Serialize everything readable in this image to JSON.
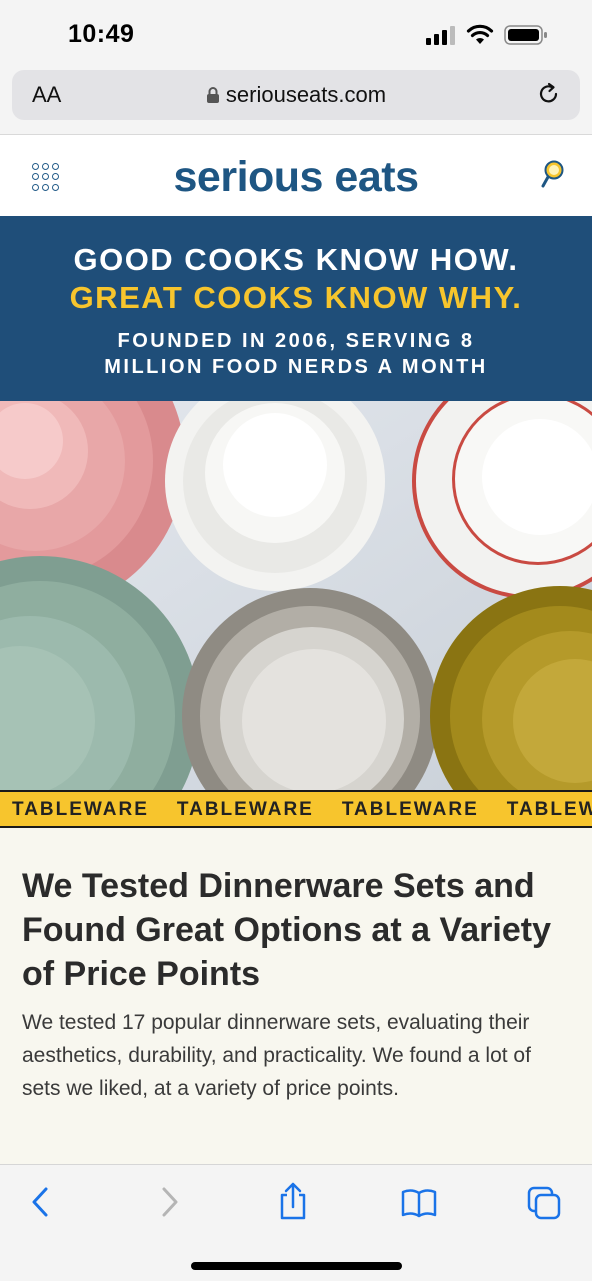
{
  "status_bar": {
    "time": "10:49"
  },
  "browser": {
    "text_size_label": "AA",
    "url": "seriouseats.com"
  },
  "site": {
    "logo": "serious eats"
  },
  "banner": {
    "line1": "GOOD COOKS KNOW HOW.",
    "line2": "GREAT COOKS KNOW WHY.",
    "tagline": "FOUNDED IN 2006, SERVING 8 MILLION FOOD NERDS A MONTH"
  },
  "ticker": {
    "items": [
      "TABLEWARE",
      "TABLEWARE",
      "TABLEWARE",
      "TABLEWARE"
    ]
  },
  "article": {
    "headline": "We Tested Dinnerware Sets and Found Great Options at a Variety of Price Points",
    "summary": "We tested 17 popular dinnerware sets, evaluating their aesthetics, durability, and practicality. We found a lot of sets we liked, at a variety of price points."
  },
  "colors": {
    "brand_blue": "#1f4e79",
    "accent_yellow": "#f7c52d",
    "ios_blue": "#1a73e8"
  },
  "icons": {
    "menu": "grid-menu-icon",
    "search": "magnifier-icon",
    "back": "chevron-left-icon",
    "forward": "chevron-right-icon",
    "share": "share-icon",
    "bookmarks": "book-icon",
    "tabs": "tabs-icon"
  }
}
